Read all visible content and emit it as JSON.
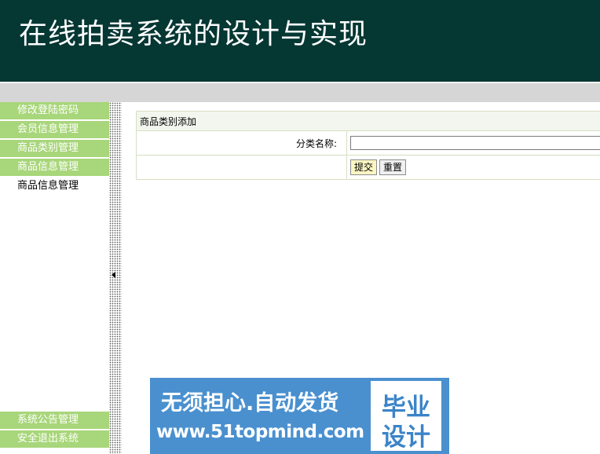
{
  "header": {
    "title": "在线拍卖系统的设计与实现"
  },
  "sidebar": {
    "items": [
      {
        "label": "修改登陆密码"
      },
      {
        "label": "会员信息管理"
      },
      {
        "label": "商品类别管理"
      },
      {
        "label": "商品信息管理"
      }
    ],
    "sub_items": [
      {
        "label": "商品信息管理"
      }
    ],
    "bottom_items": [
      {
        "label": "系统公告管理"
      },
      {
        "label": "安全退出系统"
      }
    ]
  },
  "form": {
    "caption": "商品类别添加",
    "field_label": "分类名称:",
    "field_value": "",
    "submit_label": "提交",
    "reset_label": "重置"
  },
  "banner": {
    "line1": "无须担心.自动发货",
    "line2": "www.51topmind.com",
    "badge_line1": "毕业",
    "badge_line2": "设计"
  },
  "colors": {
    "header_bg": "#053733",
    "menu_bg": "#a8d67a",
    "banner_bg": "#4a90cf"
  }
}
